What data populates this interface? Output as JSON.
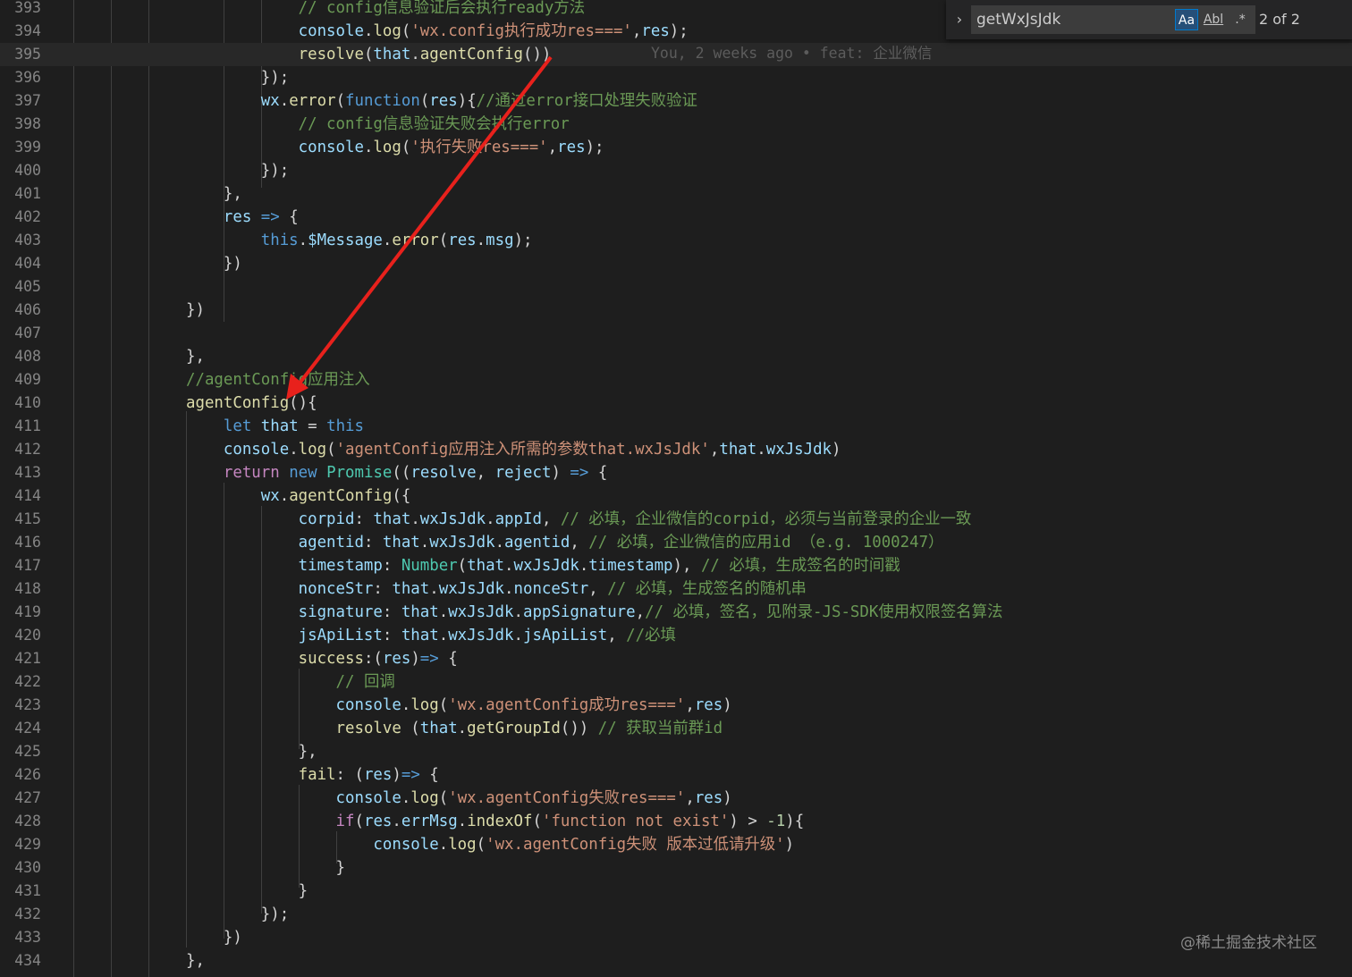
{
  "find_widget": {
    "toggle_icon": "chevron-right-icon",
    "query": "getWxJsJdk",
    "match_case_label": "Aa",
    "whole_word_label": "Abl",
    "regex_label": ".*",
    "match_count": "2 of 2"
  },
  "blame": "You, 2 weeks ago • feat: 企业微信",
  "watermark": "@稀土掘金技术社区",
  "colors": {
    "comment": "#6a9955",
    "string": "#ce9178",
    "keyword": "#569cd6",
    "control": "#c586c0",
    "function": "#dcdcaa",
    "variable": "#9cdcfe",
    "type": "#4ec9b0",
    "number": "#b5cea8",
    "text": "#d4d4d4",
    "arrow": "#e8211c"
  },
  "lines": [
    {
      "n": "393",
      "tokens": [
        [
          "c",
          "            "
        ],
        [
          "com",
          "// config信息验证后会执行ready方法"
        ]
      ]
    },
    {
      "n": "394",
      "tokens": [
        [
          "t",
          "            "
        ],
        [
          "v",
          "console"
        ],
        [
          "t",
          "."
        ],
        [
          "f",
          "log"
        ],
        [
          "t",
          "("
        ],
        [
          "s",
          "'wx.config执行成功res==='"
        ],
        [
          "t",
          ","
        ],
        [
          "v",
          "res"
        ],
        [
          "t",
          ");"
        ]
      ]
    },
    {
      "n": "395",
      "current": true,
      "tokens": [
        [
          "t",
          "            "
        ],
        [
          "f",
          "resolve"
        ],
        [
          "t",
          "("
        ],
        [
          "v",
          "that"
        ],
        [
          "t",
          "."
        ],
        [
          "f",
          "agentConfig"
        ],
        [
          "t",
          "())"
        ]
      ]
    },
    {
      "n": "396",
      "tokens": [
        [
          "t",
          "        "
        ],
        [
          "t",
          "})"
        ],
        [
          "t",
          ";"
        ]
      ]
    },
    {
      "n": "397",
      "tokens": [
        [
          "t",
          "        "
        ],
        [
          "v",
          "wx"
        ],
        [
          "t",
          "."
        ],
        [
          "f",
          "error"
        ],
        [
          "t",
          "("
        ],
        [
          "k",
          "function"
        ],
        [
          "t",
          "("
        ],
        [
          "v",
          "res"
        ],
        [
          "t",
          "){"
        ],
        [
          "com",
          "//通过error接口处理失败验证"
        ]
      ]
    },
    {
      "n": "398",
      "tokens": [
        [
          "t",
          "            "
        ],
        [
          "com",
          "// config信息验证失败会执行error"
        ]
      ]
    },
    {
      "n": "399",
      "tokens": [
        [
          "t",
          "            "
        ],
        [
          "v",
          "console"
        ],
        [
          "t",
          "."
        ],
        [
          "f",
          "log"
        ],
        [
          "t",
          "("
        ],
        [
          "s",
          "'执行失败res==='"
        ],
        [
          "t",
          ","
        ],
        [
          "v",
          "res"
        ],
        [
          "t",
          ");"
        ]
      ]
    },
    {
      "n": "400",
      "tokens": [
        [
          "t",
          "        "
        ],
        [
          "t",
          "});"
        ]
      ]
    },
    {
      "n": "401",
      "tokens": [
        [
          "t",
          "    "
        ],
        [
          "t",
          "},"
        ]
      ]
    },
    {
      "n": "402",
      "tokens": [
        [
          "t",
          "    "
        ],
        [
          "v",
          "res"
        ],
        [
          "t",
          " "
        ],
        [
          "k",
          "=>"
        ],
        [
          "t",
          " {"
        ]
      ]
    },
    {
      "n": "403",
      "tokens": [
        [
          "t",
          "        "
        ],
        [
          "k",
          "this"
        ],
        [
          "t",
          "."
        ],
        [
          "v",
          "$Message"
        ],
        [
          "t",
          "."
        ],
        [
          "f",
          "error"
        ],
        [
          "t",
          "("
        ],
        [
          "v",
          "res"
        ],
        [
          "t",
          "."
        ],
        [
          "v",
          "msg"
        ],
        [
          "t",
          ");"
        ]
      ]
    },
    {
      "n": "404",
      "tokens": [
        [
          "t",
          "    "
        ],
        [
          "t",
          "})"
        ]
      ]
    },
    {
      "n": "405",
      "tokens": []
    },
    {
      "n": "406",
      "tokens": [
        [
          "t",
          "})"
        ]
      ]
    },
    {
      "n": "407",
      "tokens": []
    },
    {
      "n": "408",
      "tokens": [
        [
          "t",
          "},"
        ]
      ]
    },
    {
      "n": "409",
      "tokens": [
        [
          "com",
          "//agentConfig应用注入"
        ]
      ]
    },
    {
      "n": "410",
      "tokens": [
        [
          "f",
          "agentConfig"
        ],
        [
          "t",
          "(){"
        ]
      ]
    },
    {
      "n": "411",
      "tokens": [
        [
          "t",
          "    "
        ],
        [
          "k",
          "let"
        ],
        [
          "t",
          " "
        ],
        [
          "v",
          "that"
        ],
        [
          "t",
          " = "
        ],
        [
          "k",
          "this"
        ]
      ]
    },
    {
      "n": "412",
      "tokens": [
        [
          "t",
          "    "
        ],
        [
          "v",
          "console"
        ],
        [
          "t",
          "."
        ],
        [
          "f",
          "log"
        ],
        [
          "t",
          "("
        ],
        [
          "s",
          "'agentConfig应用注入所需的参数that.wxJsJdk'"
        ],
        [
          "t",
          ","
        ],
        [
          "v",
          "that"
        ],
        [
          "t",
          "."
        ],
        [
          "v",
          "wxJsJdk"
        ],
        [
          "t",
          ")"
        ]
      ]
    },
    {
      "n": "413",
      "tokens": [
        [
          "t",
          "    "
        ],
        [
          "ctl",
          "return"
        ],
        [
          "t",
          " "
        ],
        [
          "k",
          "new"
        ],
        [
          "t",
          " "
        ],
        [
          "ty",
          "Promise"
        ],
        [
          "t",
          "(("
        ],
        [
          "v",
          "resolve"
        ],
        [
          "t",
          ", "
        ],
        [
          "v",
          "reject"
        ],
        [
          "t",
          ") "
        ],
        [
          "k",
          "=>"
        ],
        [
          "t",
          " {"
        ]
      ]
    },
    {
      "n": "414",
      "tokens": [
        [
          "t",
          "        "
        ],
        [
          "v",
          "wx"
        ],
        [
          "t",
          "."
        ],
        [
          "f",
          "agentConfig"
        ],
        [
          "t",
          "({"
        ]
      ]
    },
    {
      "n": "415",
      "tokens": [
        [
          "t",
          "            "
        ],
        [
          "v",
          "corpid"
        ],
        [
          "t",
          ": "
        ],
        [
          "v",
          "that"
        ],
        [
          "t",
          "."
        ],
        [
          "v",
          "wxJsJdk"
        ],
        [
          "t",
          "."
        ],
        [
          "v",
          "appId"
        ],
        [
          "t",
          ", "
        ],
        [
          "com",
          "// 必填，企业微信的corpid，必须与当前登录的企业一致"
        ]
      ]
    },
    {
      "n": "416",
      "tokens": [
        [
          "t",
          "            "
        ],
        [
          "v",
          "agentid"
        ],
        [
          "t",
          ": "
        ],
        [
          "v",
          "that"
        ],
        [
          "t",
          "."
        ],
        [
          "v",
          "wxJsJdk"
        ],
        [
          "t",
          "."
        ],
        [
          "v",
          "agentid"
        ],
        [
          "t",
          ", "
        ],
        [
          "com",
          "// 必填，企业微信的应用id （e.g. 1000247）"
        ]
      ]
    },
    {
      "n": "417",
      "tokens": [
        [
          "t",
          "            "
        ],
        [
          "v",
          "timestamp"
        ],
        [
          "t",
          ": "
        ],
        [
          "ty",
          "Number"
        ],
        [
          "t",
          "("
        ],
        [
          "v",
          "that"
        ],
        [
          "t",
          "."
        ],
        [
          "v",
          "wxJsJdk"
        ],
        [
          "t",
          "."
        ],
        [
          "v",
          "timestamp"
        ],
        [
          "t",
          "), "
        ],
        [
          "com",
          "// 必填，生成签名的时间戳"
        ]
      ]
    },
    {
      "n": "418",
      "tokens": [
        [
          "t",
          "            "
        ],
        [
          "v",
          "nonceStr"
        ],
        [
          "t",
          ": "
        ],
        [
          "v",
          "that"
        ],
        [
          "t",
          "."
        ],
        [
          "v",
          "wxJsJdk"
        ],
        [
          "t",
          "."
        ],
        [
          "v",
          "nonceStr"
        ],
        [
          "t",
          ", "
        ],
        [
          "com",
          "// 必填，生成签名的随机串"
        ]
      ]
    },
    {
      "n": "419",
      "tokens": [
        [
          "t",
          "            "
        ],
        [
          "v",
          "signature"
        ],
        [
          "t",
          ": "
        ],
        [
          "v",
          "that"
        ],
        [
          "t",
          "."
        ],
        [
          "v",
          "wxJsJdk"
        ],
        [
          "t",
          "."
        ],
        [
          "v",
          "appSignature"
        ],
        [
          "t",
          ","
        ],
        [
          "com",
          "// 必填，签名，见附录-JS-SDK使用权限签名算法"
        ]
      ]
    },
    {
      "n": "420",
      "tokens": [
        [
          "t",
          "            "
        ],
        [
          "v",
          "jsApiList"
        ],
        [
          "t",
          ": "
        ],
        [
          "v",
          "that"
        ],
        [
          "t",
          "."
        ],
        [
          "v",
          "wxJsJdk"
        ],
        [
          "t",
          "."
        ],
        [
          "v",
          "jsApiList"
        ],
        [
          "t",
          ", "
        ],
        [
          "com",
          "//必填"
        ]
      ]
    },
    {
      "n": "421",
      "tokens": [
        [
          "t",
          "            "
        ],
        [
          "f",
          "success"
        ],
        [
          "t",
          ":("
        ],
        [
          "v",
          "res"
        ],
        [
          "t",
          ")"
        ],
        [
          "k",
          "=>"
        ],
        [
          "t",
          " {"
        ]
      ]
    },
    {
      "n": "422",
      "tokens": [
        [
          "t",
          "                "
        ],
        [
          "com",
          "// 回调"
        ]
      ]
    },
    {
      "n": "423",
      "tokens": [
        [
          "t",
          "                "
        ],
        [
          "v",
          "console"
        ],
        [
          "t",
          "."
        ],
        [
          "f",
          "log"
        ],
        [
          "t",
          "("
        ],
        [
          "s",
          "'wx.agentConfig成功res==='"
        ],
        [
          "t",
          ","
        ],
        [
          "v",
          "res"
        ],
        [
          "t",
          ")"
        ]
      ]
    },
    {
      "n": "424",
      "tokens": [
        [
          "t",
          "                "
        ],
        [
          "f",
          "resolve"
        ],
        [
          "t",
          " ("
        ],
        [
          "v",
          "that"
        ],
        [
          "t",
          "."
        ],
        [
          "f",
          "getGroupId"
        ],
        [
          "t",
          "()) "
        ],
        [
          "com",
          "// 获取当前群id"
        ]
      ]
    },
    {
      "n": "425",
      "tokens": [
        [
          "t",
          "            "
        ],
        [
          "t",
          "},"
        ]
      ]
    },
    {
      "n": "426",
      "tokens": [
        [
          "t",
          "            "
        ],
        [
          "f",
          "fail"
        ],
        [
          "t",
          ": ("
        ],
        [
          "v",
          "res"
        ],
        [
          "t",
          ")"
        ],
        [
          "k",
          "=>"
        ],
        [
          "t",
          " {"
        ]
      ]
    },
    {
      "n": "427",
      "tokens": [
        [
          "t",
          "                "
        ],
        [
          "v",
          "console"
        ],
        [
          "t",
          "."
        ],
        [
          "f",
          "log"
        ],
        [
          "t",
          "("
        ],
        [
          "s",
          "'wx.agentConfig失败res==='"
        ],
        [
          "t",
          ","
        ],
        [
          "v",
          "res"
        ],
        [
          "t",
          ")"
        ]
      ]
    },
    {
      "n": "428",
      "tokens": [
        [
          "t",
          "                "
        ],
        [
          "ctl",
          "if"
        ],
        [
          "t",
          "("
        ],
        [
          "v",
          "res"
        ],
        [
          "t",
          "."
        ],
        [
          "v",
          "errMsg"
        ],
        [
          "t",
          "."
        ],
        [
          "f",
          "indexOf"
        ],
        [
          "t",
          "("
        ],
        [
          "s",
          "'function not exist'"
        ],
        [
          "t",
          ") > "
        ],
        [
          "num",
          "-1"
        ],
        [
          "t",
          "){"
        ]
      ]
    },
    {
      "n": "429",
      "tokens": [
        [
          "t",
          "                    "
        ],
        [
          "v",
          "console"
        ],
        [
          "t",
          "."
        ],
        [
          "f",
          "log"
        ],
        [
          "t",
          "("
        ],
        [
          "s",
          "'wx.agentConfig失败 版本过低请升级'"
        ],
        [
          "t",
          ")"
        ]
      ]
    },
    {
      "n": "430",
      "tokens": [
        [
          "t",
          "                "
        ],
        [
          "t",
          "}"
        ]
      ]
    },
    {
      "n": "431",
      "tokens": [
        [
          "t",
          "            "
        ],
        [
          "t",
          "}"
        ]
      ]
    },
    {
      "n": "432",
      "tokens": [
        [
          "t",
          "        "
        ],
        [
          "t",
          "});"
        ]
      ]
    },
    {
      "n": "433",
      "tokens": [
        [
          "t",
          "    "
        ],
        [
          "t",
          "})"
        ]
      ]
    },
    {
      "n": "434",
      "tokens": [
        [
          "t",
          "},"
        ]
      ]
    }
  ]
}
